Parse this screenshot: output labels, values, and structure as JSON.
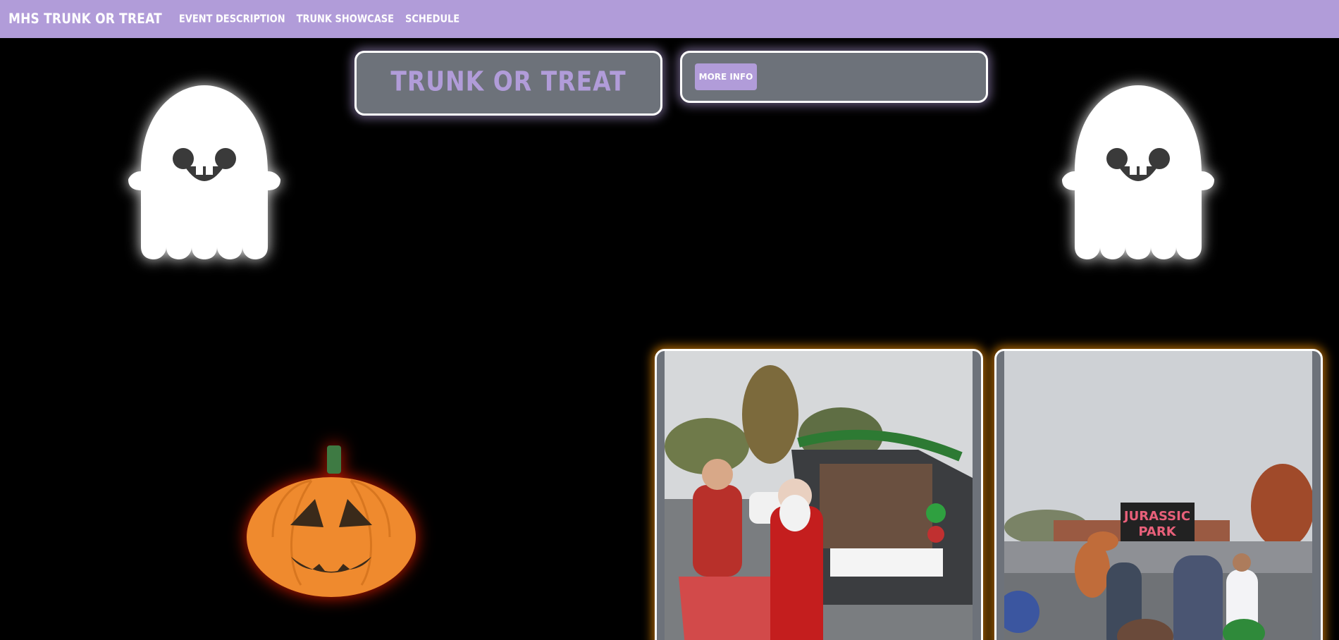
{
  "nav": {
    "brand": "MHS TRUNK OR TREAT",
    "links": [
      "EVENT DESCRIPTION",
      "TRUNK SHOWCASE",
      "SCHEDULE"
    ]
  },
  "hero": {
    "title": "TRUNK OR TREAT",
    "more_info_label": "MORE INFO"
  },
  "showcase": {
    "photo2_sign": [
      "JURASSIC",
      "PARK"
    ]
  },
  "colors": {
    "accent": "#b19cd9",
    "card": "#6d727a",
    "glow_orange": "#ff9600",
    "pumpkin": "#f0882c"
  }
}
